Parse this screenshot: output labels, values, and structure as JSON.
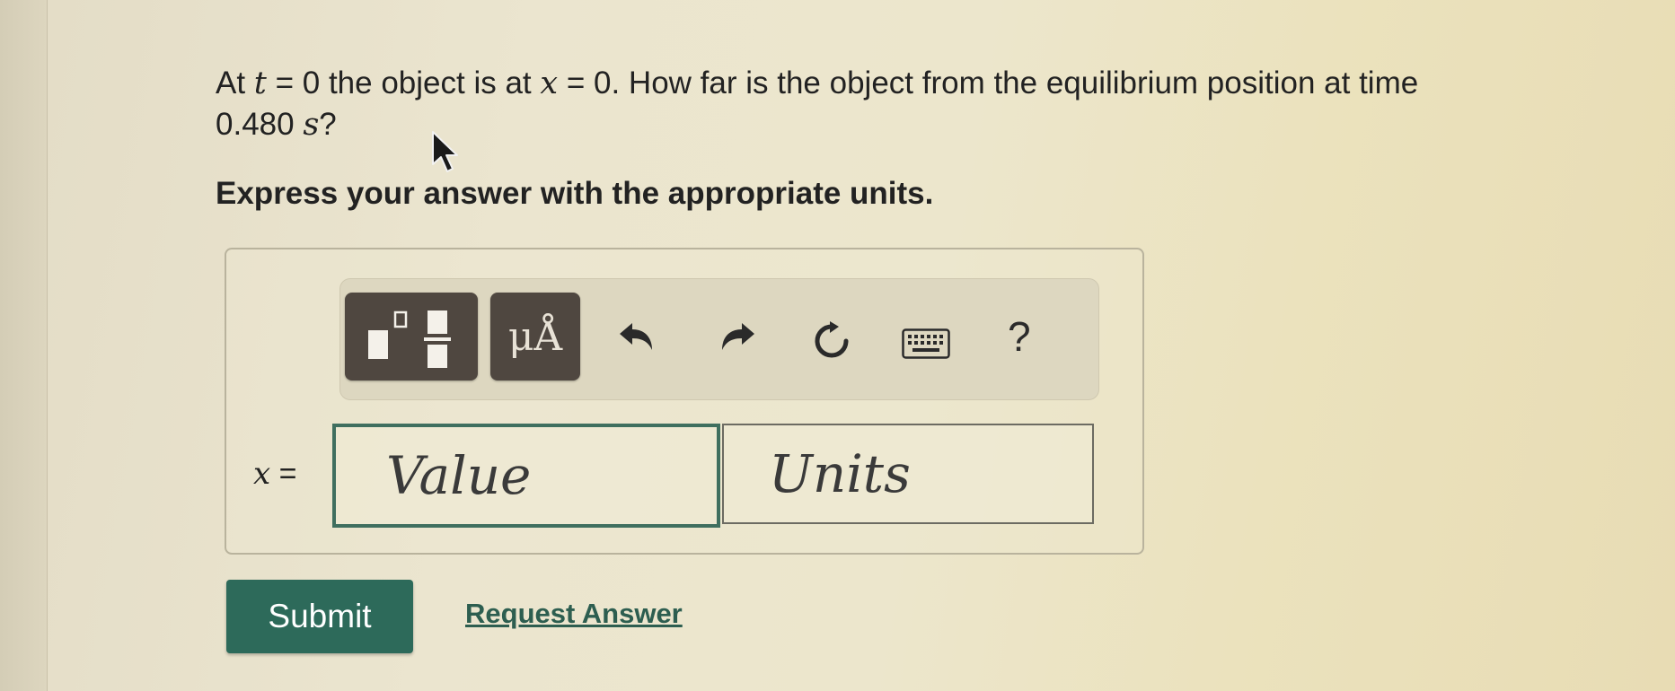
{
  "question": {
    "p1": "At ",
    "var_t": "t",
    "p2": " = 0 the object is at ",
    "var_x": "x",
    "p3": " = 0. How far is the object from the equilibrium position at time",
    "line2_value": "0.480 ",
    "line2_unit": "s",
    "line2_end": "?"
  },
  "instruction": "Express your answer with the appropriate units.",
  "toolbar": {
    "units_label": "μÅ",
    "help_label": "?",
    "icons": [
      "templates-icon",
      "undo-icon",
      "redo-icon",
      "reset-icon",
      "keyboard-icon",
      "help-icon"
    ]
  },
  "answer": {
    "variable": "x",
    "equals": " =",
    "value_placeholder": "Value",
    "units_placeholder": "Units"
  },
  "actions": {
    "submit_label": "Submit",
    "request_label": "Request Answer"
  },
  "colors": {
    "submit_bg": "#2d6a5a",
    "link": "#2d5e50",
    "tool_button": "#4f4740",
    "active_border": "#3f6f5f"
  }
}
